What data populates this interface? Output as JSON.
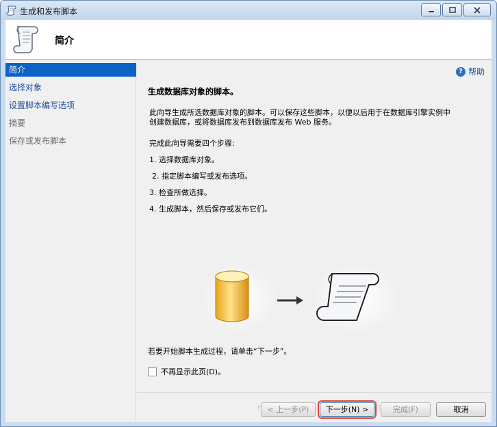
{
  "window": {
    "title": "生成和发布脚本"
  },
  "header": {
    "title": "简介"
  },
  "sidebar": {
    "items": [
      {
        "label": "简介",
        "state": "active"
      },
      {
        "label": "选择对象",
        "state": "link"
      },
      {
        "label": "设置脚本编写选项",
        "state": "link"
      },
      {
        "label": "摘要",
        "state": "disabled"
      },
      {
        "label": "保存或发布脚本",
        "state": "disabled"
      }
    ]
  },
  "main": {
    "help_label": "帮助",
    "heading": "生成数据库对象的脚本。",
    "intro_line1": "此向导生成所选数据库对象的脚本。可以保存这些脚本，以便以后用于在数据库引擎实例中",
    "intro_line2": "创建数据库，或将数据库发布到数据库发布 Web 服务。",
    "steps_heading": "完成此向导需要四个步骤:",
    "steps": [
      "1.  选择数据库对象。",
      "2.  指定脚本编写或发布选项。",
      "3.  检查所做选择。",
      "4.  生成脚本，然后保存或发布它们。"
    ],
    "start_hint": "若要开始脚本生成过程，请单击“下一步”。",
    "dont_show_label": "不再显示此页(D)。",
    "dont_show_checked": false
  },
  "footer": {
    "back_label": "< 上一步(P)",
    "next_label": "下一步(N) >",
    "finish_label": "完成(F)",
    "cancel_label": "取消",
    "watermark": "http://blog.csdn.net/wx1847774993"
  },
  "colors": {
    "accent": "#0a63c5",
    "link": "#1c4f9a",
    "focus_outline": "#e0453c"
  }
}
